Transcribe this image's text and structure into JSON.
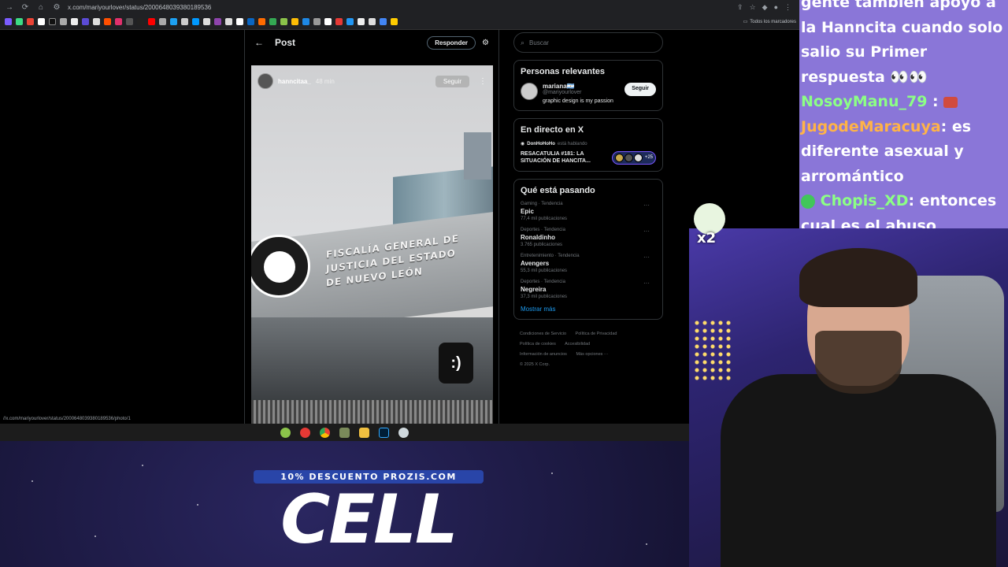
{
  "browser": {
    "url": "x.com/mariyourlover/status/2000648039380189536",
    "bookmark_folder_label": "Todos los marcadores",
    "status_url": "//x.com/mariyourlover/status/2000648039380189536/photo/1"
  },
  "post": {
    "title": "Post",
    "reply_label": "Responder",
    "story": {
      "username": "hanncitaa_",
      "time": "48 min",
      "follow_label": "Seguir",
      "building_line_1": "FISCALÍA GENERAL DE",
      "building_line_2": "JUSTICIA DEL ESTADO",
      "building_line_3": "DE NUEVO LEÓN",
      "sticker_text": ":)"
    }
  },
  "sidebar": {
    "search_placeholder": "Buscar",
    "relevant": {
      "title": "Personas relevantes",
      "name": "mariana🇦🇷",
      "handle": "@mariyourlover",
      "bio": "graphic design is my passion",
      "follow_label": "Seguir"
    },
    "live": {
      "title": "En directo en X",
      "host": "DonHoHoHo",
      "host_status": "está hablando",
      "space_title": "RESACATULIA #181: LA SITUACIÓN DE HANCITA...",
      "listener_count": "+25"
    },
    "trends": {
      "title": "Qué está pasando",
      "items": [
        {
          "meta": "Gaming · Tendencia",
          "name": "Epic",
          "count": "77,4 mil publicaciones"
        },
        {
          "meta": "Deportes · Tendencia",
          "name": "Ronaldinho",
          "count": "3.765 publicaciones"
        },
        {
          "meta": "Entretenimiento · Tendencia",
          "name": "Avengers",
          "count": "55,3 mil publicaciones"
        },
        {
          "meta": "Deportes · Tendencia",
          "name": "Negreira",
          "count": "37,3 mil publicaciones"
        }
      ],
      "show_more": "Mostrar más"
    },
    "footer": [
      "Condiciones de Servicio",
      "Política de Privacidad",
      "Política de cookies",
      "Accesibilidad",
      "Información de anuncios",
      "Más opciones ···",
      "© 2025 X Corp."
    ]
  },
  "chat": {
    "line1": "gente también apoyo a la Hanncita cuando solo salio su Primer respuesta 👀👀",
    "msg2_user": "NosoyManu_79",
    "msg3_user": "JugodeMaracuya",
    "msg3_text": ": es diferente asexual y arromántico",
    "msg4_user": "Chopis_XD",
    "msg4_text": ": entonces cual es el abuso"
  },
  "reward": {
    "multiplier": "x2"
  },
  "promo": {
    "badge": "10% DESCUENTO PROZIS.COM",
    "word": "CELL"
  },
  "colors": {
    "accent": "#1d9bf0",
    "chat_bg": "#8a76d8",
    "username_green": "#8cff85",
    "username_orange": "#ffb347",
    "promo_badge": "#2945a8"
  }
}
